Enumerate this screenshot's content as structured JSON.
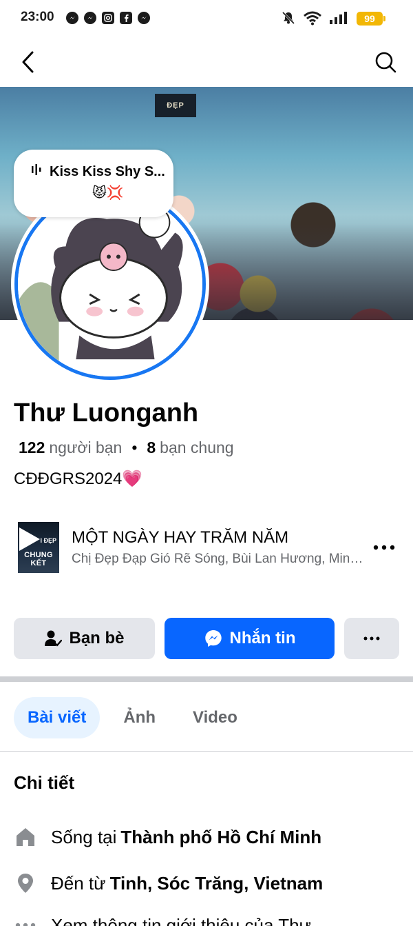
{
  "status_bar": {
    "time": "23:00",
    "battery": "99"
  },
  "cover": {
    "logo_text": "ĐẸP"
  },
  "note": {
    "text": "Kiss Kiss Shy S...",
    "emoji": "😾💢"
  },
  "profile": {
    "name": "Thư Luonganh",
    "friends_count": "122",
    "friends_label": "người bạn",
    "mutual_count": "8",
    "mutual_label": "bạn chung",
    "bio": "CĐĐGRS2024💗"
  },
  "music": {
    "album_top": "I ĐẸP",
    "album_bottom": "CHUNG KẾT",
    "title": "MỘT NGÀY HAY TRĂM NĂM",
    "artist": "Chị Đẹp Đạp Gió Rẽ Sóng, Bùi Lan Hương, Minh..."
  },
  "actions": {
    "friends_label": "Bạn bè",
    "message_label": "Nhắn tin"
  },
  "tabs": [
    {
      "label": "Bài viết"
    },
    {
      "label": "Ảnh"
    },
    {
      "label": "Video"
    }
  ],
  "details": {
    "title": "Chi tiết",
    "lives_prefix": "Sống tại",
    "lives_value": "Thành phố Hồ Chí Minh",
    "from_prefix": "Đến từ",
    "from_value": "Tinh, Sóc Trăng, Vietnam",
    "about_text": "Xem thông tin giới thiệu của Thư"
  },
  "colors": {
    "accent": "#0866ff",
    "avatar_ring": "#1877f2",
    "battery": "#f2b705"
  }
}
